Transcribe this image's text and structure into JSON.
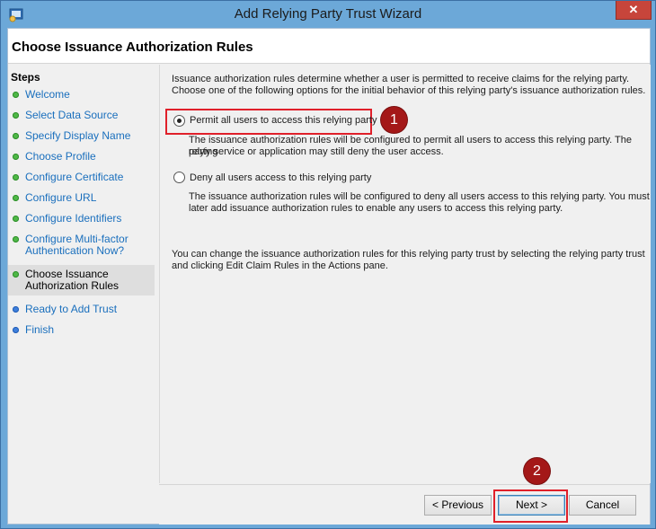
{
  "window": {
    "title": "Add Relying Party Trust Wizard",
    "close_glyph": "✕"
  },
  "header": {
    "title": "Choose Issuance Authorization Rules"
  },
  "steps": {
    "heading": "Steps",
    "items": [
      {
        "label": "Welcome",
        "status": "complete"
      },
      {
        "label": "Select Data Source",
        "status": "complete"
      },
      {
        "label": "Specify Display Name",
        "status": "complete"
      },
      {
        "label": "Choose Profile",
        "status": "complete"
      },
      {
        "label": "Configure Certificate",
        "status": "complete"
      },
      {
        "label": "Configure URL",
        "status": "complete"
      },
      {
        "label": "Configure Identifiers",
        "status": "complete"
      },
      {
        "label_line1": "Configure Multi-factor",
        "label_line2": "Authentication Now?",
        "status": "complete"
      },
      {
        "label_line1": "Choose Issuance",
        "label_line2": "Authorization Rules",
        "status": "current"
      },
      {
        "label": "Ready to Add Trust",
        "status": "pending"
      },
      {
        "label": "Finish",
        "status": "pending"
      }
    ]
  },
  "main": {
    "intro_line1": "Issuance authorization rules determine whether a user is permitted to receive claims for the relying party.",
    "intro_line2": "Choose one of the following options for the initial behavior of this relying party's issuance authorization rules.",
    "options": [
      {
        "label": "Permit all users to access this relying party",
        "selected": true,
        "desc_line1": "The issuance authorization rules will be configured to permit all users to access this relying party. The relying",
        "desc_line2": "party service or application may still deny the user access."
      },
      {
        "label": "Deny all users access to this relying party",
        "selected": false,
        "desc_line1": "The issuance authorization rules will be configured to deny all users access to this relying party. You must",
        "desc_line2": "later add issuance authorization rules to enable any users to access this relying party."
      }
    ],
    "note_line1": "You can change the issuance authorization rules for this relying party trust by selecting the relying party trust",
    "note_line2": "and clicking Edit Claim Rules in the Actions pane."
  },
  "footer": {
    "previous_label": "< Previous",
    "next_label": "Next >",
    "cancel_label": "Cancel"
  },
  "annotations": {
    "badge1": "1",
    "badge2": "2"
  },
  "colors": {
    "highlight": "#e0202a",
    "badge": "#a41818",
    "step_link": "#1a6fbd"
  }
}
